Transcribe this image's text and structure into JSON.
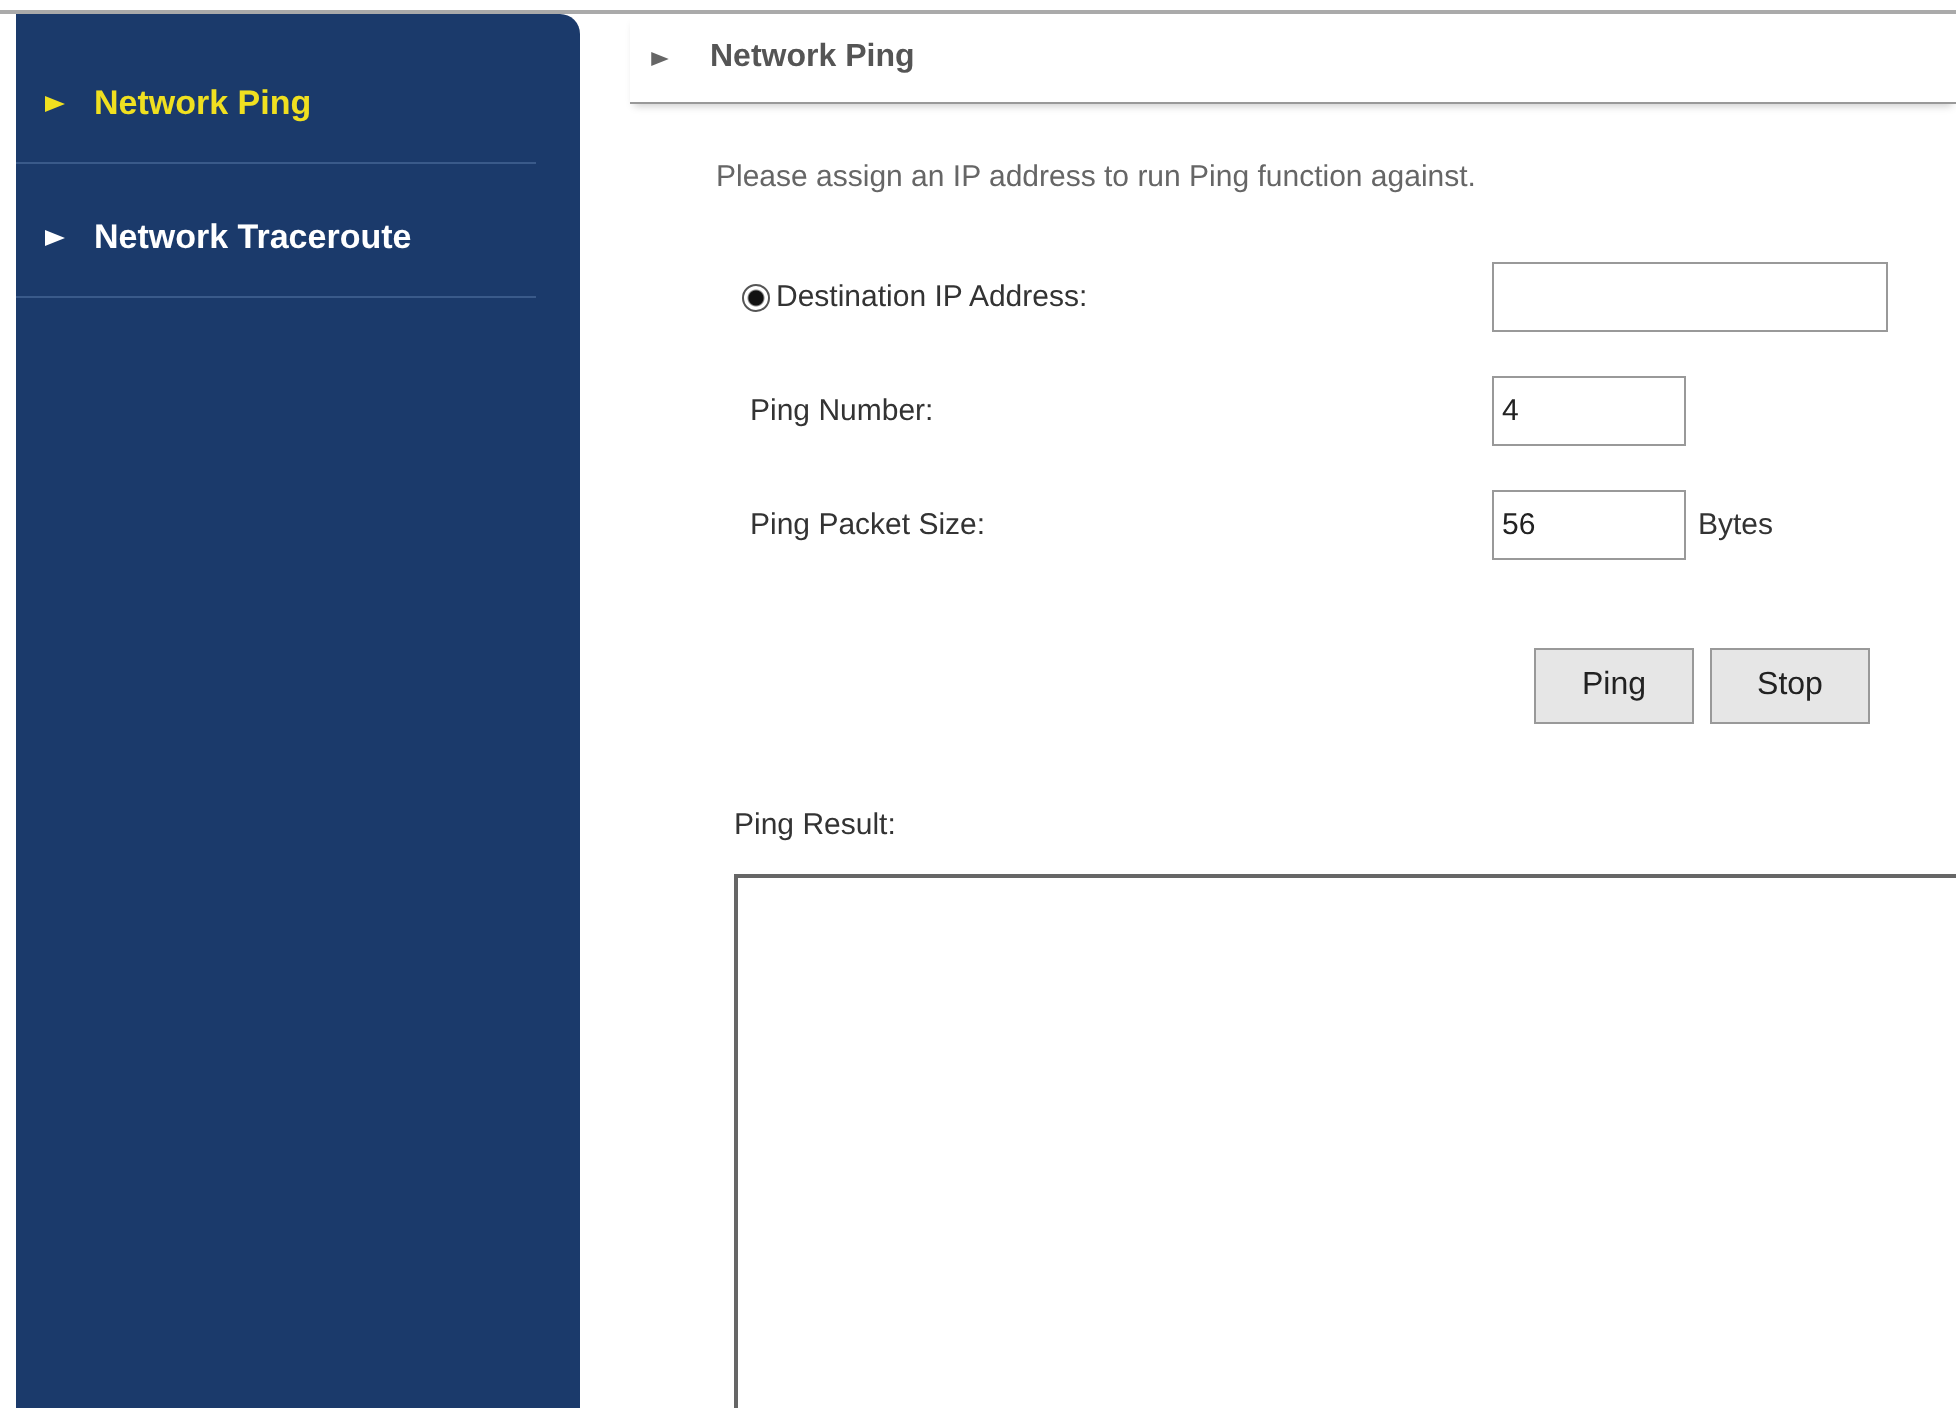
{
  "sidebar": {
    "items": [
      {
        "label": "Network Ping",
        "selected": true
      },
      {
        "label": "Network Traceroute",
        "selected": false
      }
    ]
  },
  "section": {
    "title": "Network Ping",
    "description": "Please assign an IP address to run Ping function against."
  },
  "fields": [
    {
      "kind": "radio",
      "label": "Destination IP Address:",
      "selected": true
    },
    {
      "kind": "text",
      "label": "Ping Number:",
      "value": "4"
    },
    {
      "kind": "text",
      "label": "Ping Packet Size:",
      "value": "56",
      "unit": "Bytes"
    }
  ],
  "buttons": [
    "Ping",
    "Stop"
  ],
  "result": {
    "label": "Ping Result:"
  }
}
